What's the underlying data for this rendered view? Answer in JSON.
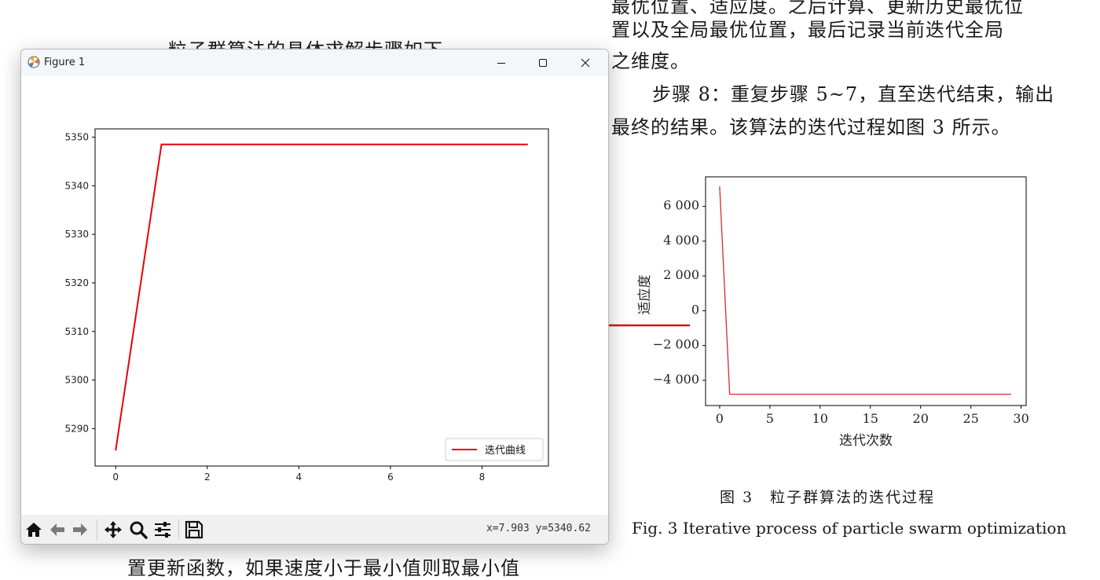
{
  "document": {
    "top_left_line": "粒子群算法的具体求解步骤如下",
    "bottom_left_line": "置更新函数，如果速度小于最小值则取最小值",
    "right_lines": [
      "最优位置、适应度。之后计算、更新历史最优位",
      "置以及全局最优位置，最后记录当前迭代全局",
      "之维度。",
      "步骤 8：重复步骤 5~7，直至迭代结束，输出",
      "最终的结果。该算法的迭代过程如图 3 所示。"
    ],
    "caption_cn": "图 3　粒子群算法的迭代过程",
    "caption_en": "Fig. 3    Iterative process of particle swarm optimization"
  },
  "window": {
    "title": "Figure 1",
    "title_icon": "matplotlib-figure-icon",
    "controls": [
      "minimize-icon",
      "maximize-icon",
      "close-icon"
    ],
    "toolbar_icons": [
      "home-icon",
      "back-icon",
      "forward-icon",
      "pan-icon",
      "zoom-icon",
      "configure-subplots-icon",
      "save-icon"
    ],
    "coords": "x=7.903  y=5340.62"
  },
  "colors": {
    "line": "#e8000b",
    "doc_line": "#d9292e",
    "arrow": "#e01010"
  },
  "chart_data": [
    {
      "type": "line",
      "title": "",
      "xlabel": "",
      "ylabel": "",
      "x": [
        0,
        1,
        2,
        3,
        4,
        5,
        6,
        7,
        8,
        9
      ],
      "series": [
        {
          "name": "迭代曲线",
          "values": [
            5285.5,
            5348.5,
            5348.5,
            5348.5,
            5348.5,
            5348.5,
            5348.5,
            5348.5,
            5348.5,
            5348.5
          ]
        }
      ],
      "xlim": [
        -0.45,
        9.45
      ],
      "ylim": [
        5282.3,
        5351.7
      ],
      "xticks": [
        0,
        2,
        4,
        6,
        8
      ],
      "xtick_labels": [
        "0",
        "2",
        "4",
        "6",
        "8"
      ],
      "yticks": [
        5290,
        5300,
        5310,
        5320,
        5330,
        5340,
        5350
      ],
      "ytick_labels": [
        "5290",
        "5300",
        "5310",
        "5320",
        "5330",
        "5340",
        "5350"
      ],
      "grid": false,
      "legend": "lower-right"
    },
    {
      "type": "line",
      "title": "",
      "xlabel": "迭代次数",
      "ylabel": "适应度",
      "x": [
        0,
        1,
        2,
        3,
        4,
        5,
        6,
        7,
        8,
        9,
        10,
        11,
        12,
        13,
        14,
        15,
        16,
        17,
        18,
        19,
        20,
        21,
        22,
        23,
        24,
        25,
        26,
        27,
        28,
        29
      ],
      "series": [
        {
          "values": [
            7150,
            -4800,
            -4800,
            -4800,
            -4800,
            -4800,
            -4800,
            -4800,
            -4800,
            -4800,
            -4800,
            -4800,
            -4800,
            -4800,
            -4800,
            -4800,
            -4800,
            -4800,
            -4800,
            -4800,
            -4800,
            -4800,
            -4800,
            -4800,
            -4800,
            -4800,
            -4800,
            -4800,
            -4800,
            -4800
          ]
        }
      ],
      "xlim": [
        -1.4,
        30.5
      ],
      "ylim": [
        -5450,
        7700
      ],
      "xticks": [
        0,
        5,
        10,
        15,
        20,
        25,
        30
      ],
      "xtick_labels": [
        "0",
        "5",
        "10",
        "15",
        "20",
        "25",
        "30"
      ],
      "yticks": [
        -4000,
        -2000,
        0,
        2000,
        4000,
        6000
      ],
      "ytick_labels": [
        "−4 000",
        "−2 000",
        "0",
        "2 000",
        "4 000",
        "6 000"
      ],
      "grid": false,
      "legend": "none"
    }
  ]
}
